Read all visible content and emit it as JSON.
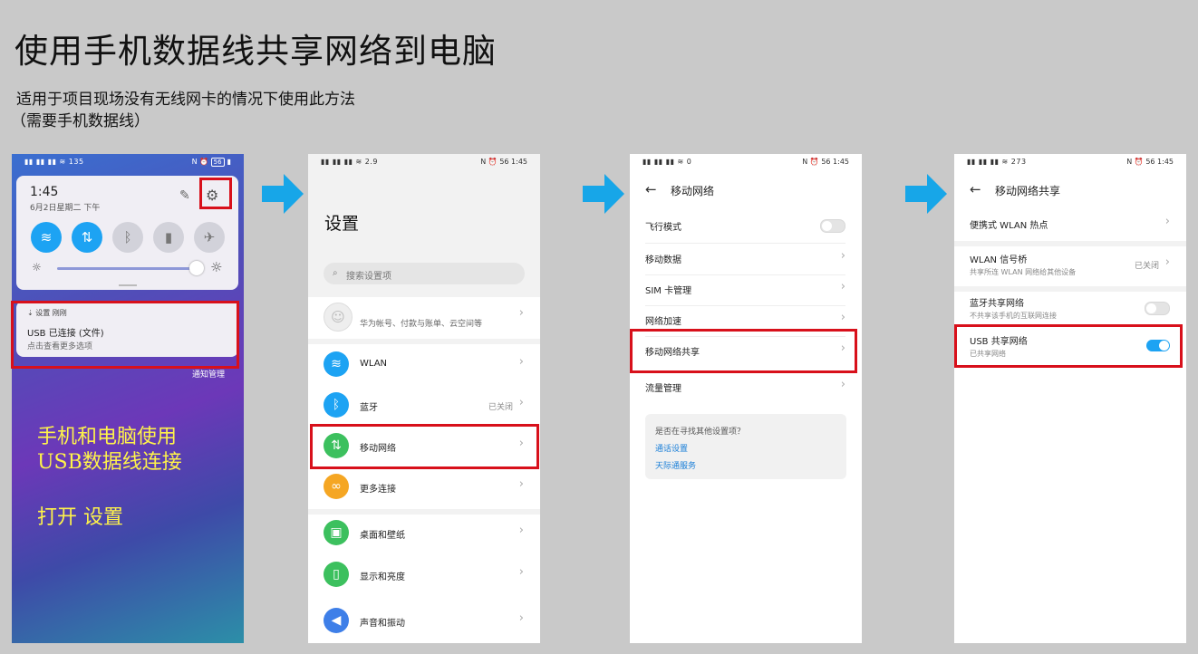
{
  "title": "使用手机数据线共享网络到电脑",
  "subtitle_line1": "适用于项目现场没有无线网卡的情况下使用此方法",
  "subtitle_line2": "（需要手机数据线）",
  "colors": {
    "highlight_red": "#d8101b",
    "arrow_blue": "#17a6e8",
    "toggle_on": "#1da3f3",
    "link_blue": "#1a7fd8"
  },
  "screen1": {
    "status_net": "135",
    "status_right": "56",
    "time": "1:45",
    "date": "6月2日星期二 下午",
    "notification": {
      "app": "设置  刚刚",
      "title": "USB 已连接 (文件)",
      "text": "点击查看更多选项"
    },
    "manage": "通知管理",
    "caption1": "手机和电脑使用",
    "caption2": "USB数据线连接",
    "caption3": "打开 设置",
    "icons": [
      "wifi-icon",
      "data-icon",
      "bluetooth-icon",
      "flashlight-icon",
      "airplane-icon"
    ]
  },
  "screen2": {
    "status_net": "2.9",
    "status_right": "56  1:45",
    "heading": "设置",
    "search_placeholder": "搜索设置项",
    "account_text": "华为帐号、付款与账单、云空间等",
    "items": [
      {
        "label": "WLAN",
        "value": ""
      },
      {
        "label": "蓝牙",
        "value": "已关闭"
      },
      {
        "label": "移动网络",
        "value": ""
      },
      {
        "label": "更多连接",
        "value": ""
      },
      {
        "label": "桌面和壁纸",
        "value": ""
      },
      {
        "label": "显示和亮度",
        "value": ""
      },
      {
        "label": "声音和振动",
        "value": ""
      }
    ]
  },
  "screen3": {
    "status_net": "0",
    "status_right": "56  1:45",
    "heading": "移动网络",
    "items": [
      "飞行模式",
      "移动数据",
      "SIM 卡管理",
      "网络加速",
      "移动网络共享",
      "流量管理"
    ],
    "hint_question": "是否在寻找其他设置项？",
    "hint_link1": "通话设置",
    "hint_link2": "天际通服务"
  },
  "screen4": {
    "status_net": "273",
    "status_right": "56  1:45",
    "heading": "移动网络共享",
    "hotspot": "便携式 WLAN 热点",
    "bridge_title": "WLAN 信号桥",
    "bridge_sub": "共享所连 WLAN 网络给其他设备",
    "bridge_value": "已关闭",
    "bt_title": "蓝牙共享网络",
    "bt_sub": "不共享该手机的互联网连接",
    "usb_title": "USB 共享网络",
    "usb_sub": "已共享网络",
    "usb_on": true
  }
}
